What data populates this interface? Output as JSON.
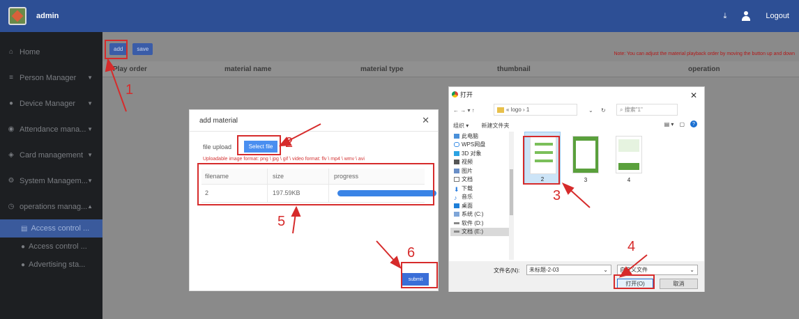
{
  "header": {
    "username": "admin",
    "download_icon": "download-icon",
    "user_icon": "user-icon",
    "logout_label": "Logout"
  },
  "sidebar": {
    "items": [
      {
        "label": "Home",
        "icon": "home-icon"
      },
      {
        "label": "Person Manager",
        "icon": "list-icon"
      },
      {
        "label": "Device Manager",
        "icon": "device-icon"
      },
      {
        "label": "Attendance mana...",
        "icon": "clock-icon"
      },
      {
        "label": "Card management",
        "icon": "card-icon"
      },
      {
        "label": "System Managem...",
        "icon": "gear-icon"
      },
      {
        "label": "operations manag...",
        "icon": "clock-icon"
      }
    ],
    "subitems": [
      {
        "label": "Access control ..."
      },
      {
        "label": "Access control ..."
      },
      {
        "label": "Advertising sta..."
      }
    ]
  },
  "toolbar": {
    "add_label": "add",
    "save_label": "save"
  },
  "note": "Note: You can adjust the material playback order by moving the button up and down",
  "table": {
    "headers": [
      "Play order",
      "material name",
      "material type",
      "thumbnail",
      "operation"
    ]
  },
  "add_material_dialog": {
    "title": "add material",
    "file_upload_label": "file upload",
    "select_label": "Select file",
    "format_note": "Uploadable image format: png \\ jpg \\ gif \\ video format: flv \\ mp4 \\ wmv \\ avi",
    "columns": [
      "filename",
      "size",
      "progress"
    ],
    "rows": [
      {
        "filename": "2",
        "size": "197.59KB",
        "progress": 1.0
      }
    ],
    "submit_label": "submit"
  },
  "open_dialog": {
    "title": "打开",
    "path": "« logo › 1",
    "search_placeholder": "搜索\"1\"",
    "organize": "组织 ▾",
    "new_folder": "新建文件夹",
    "tree": [
      "此电脑",
      "WPS网盘",
      "3D 对象",
      "视频",
      "图片",
      "文档",
      "下载",
      "音乐",
      "桌面",
      "系统 (C:)",
      "软件 (D:)",
      "文档 (E:)"
    ],
    "files": [
      {
        "name": "2"
      },
      {
        "name": "3"
      },
      {
        "name": "4"
      }
    ],
    "filename_label": "文件名(N):",
    "filename_value": "未标题-2-03",
    "filetype_value": "自定义文件",
    "open_label": "打开(O)",
    "cancel_label": "取消"
  },
  "annotations": [
    "1",
    "2",
    "3",
    "4",
    "5",
    "6"
  ],
  "colors": {
    "header": "#2d4f95",
    "sidebar": "#1d1f22",
    "accent": "#3a84e6",
    "annotation": "#d62b2b"
  }
}
